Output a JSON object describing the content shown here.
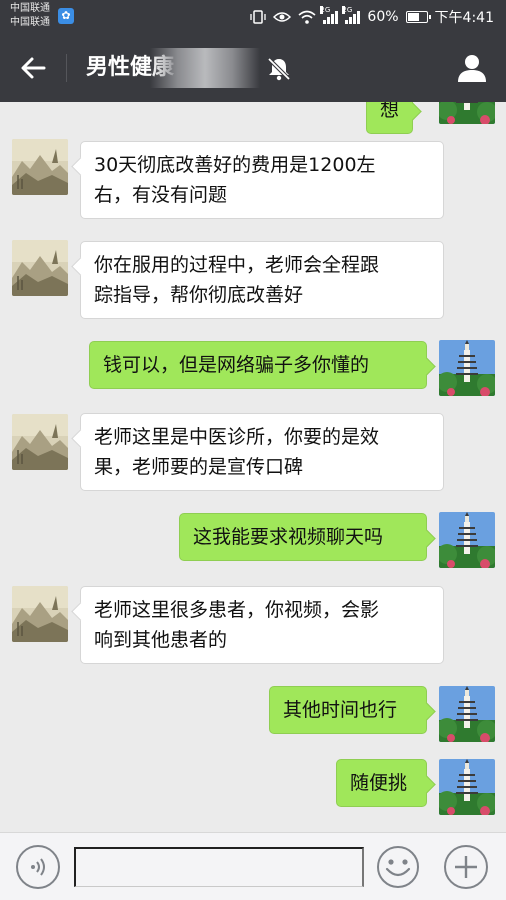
{
  "status_bar": {
    "carrier_1": "中国联通",
    "carrier_2": "中国联通",
    "signal_1_tag": "2G",
    "signal_2_tag": "2G",
    "battery": "60%",
    "time": "下午4:41"
  },
  "header": {
    "title": "男性健康",
    "back_icon": "arrow-left-icon",
    "mute_icon": "bell-off-icon",
    "profile_icon": "person-icon"
  },
  "messages": [
    {
      "side": "out",
      "text": "想"
    },
    {
      "side": "in",
      "lines": [
        "30天彻底改善好的费用是1200左",
        "右，有没有问题"
      ]
    },
    {
      "side": "in",
      "lines": [
        "你在服用的过程中，老师会全程跟",
        "踪指导，帮你彻底改善好"
      ]
    },
    {
      "side": "out",
      "text": "钱可以，但是网络骗子多你懂的"
    },
    {
      "side": "in",
      "lines": [
        "老师这里是中医诊所，你要的是效",
        "果，老师要的是宣传口碑"
      ]
    },
    {
      "side": "out",
      "text": "这我能要求视频聊天吗"
    },
    {
      "side": "in",
      "lines": [
        "老师这里很多患者，你视频，会影",
        "响到其他患者的"
      ]
    },
    {
      "side": "out",
      "text": "其他时间也行"
    },
    {
      "side": "out",
      "text": "随便挑"
    }
  ],
  "input_bar": {
    "voice_icon": "voice-icon",
    "emoji_icon": "emoji-icon",
    "plus_icon": "plus-icon",
    "input_value": ""
  },
  "colors": {
    "header_bg": "#393a3f",
    "chat_bg": "#ebebeb",
    "outgoing_bubble": "#a0e75a",
    "incoming_bubble": "#ffffff"
  }
}
